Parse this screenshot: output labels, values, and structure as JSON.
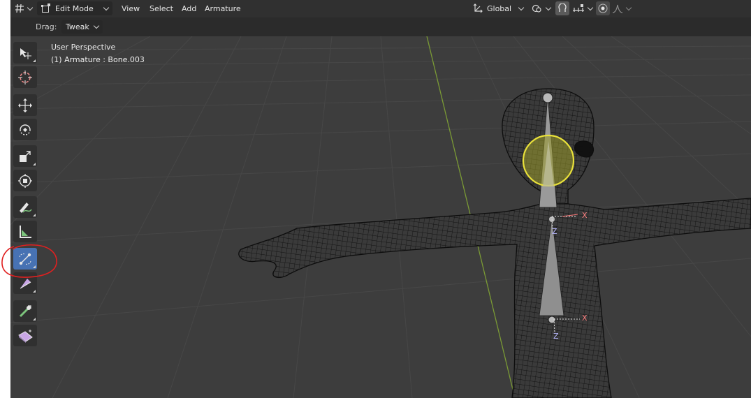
{
  "header": {
    "editor_type_icon": "grid-icon",
    "mode": "Edit Mode",
    "menus": [
      "View",
      "Select",
      "Add",
      "Armature"
    ],
    "orientation": "Global",
    "pivot_icon": "pivot-icon",
    "snap_icon": "snap-magnet-icon",
    "snap_target_icon": "snap-increment-icon",
    "proportional_icon": "proportional-edit-icon",
    "falloff_icon": "falloff-curve-icon"
  },
  "tool_settings": {
    "drag_label": "Drag:",
    "drag_value": "Tweak"
  },
  "viewport": {
    "view_name": "User Perspective",
    "object_info": "(1) Armature : Bone.003",
    "axis_labels": {
      "x1": "X",
      "z1": "Z",
      "x2": "X",
      "z2": "Z"
    }
  },
  "toolbar": {
    "tools": [
      {
        "name": "select-box-tool",
        "icon": "select-box-icon",
        "active": false
      },
      {
        "name": "cursor-tool",
        "icon": "cursor-icon",
        "active": false
      },
      {
        "name": "move-tool",
        "icon": "move-icon",
        "active": false
      },
      {
        "name": "rotate-tool",
        "icon": "rotate-icon",
        "active": false
      },
      {
        "name": "scale-tool",
        "icon": "scale-icon",
        "active": false
      },
      {
        "name": "transform-tool",
        "icon": "transform-icon",
        "active": false
      },
      {
        "name": "annotate-tool",
        "icon": "annotate-icon",
        "active": false
      },
      {
        "name": "measure-tool",
        "icon": "measure-icon",
        "active": false
      },
      {
        "name": "roll-tool",
        "icon": "bone-roll-icon",
        "active": true
      },
      {
        "name": "bone-size-tool",
        "icon": "bone-size-icon",
        "active": false
      },
      {
        "name": "extrude-tool",
        "icon": "extrude-icon",
        "active": false
      },
      {
        "name": "bone-envelope-tool",
        "icon": "bone-envelope-icon",
        "active": false
      }
    ]
  },
  "colors": {
    "header_bg": "#303030",
    "viewport_bg": "#3d3d3d",
    "active_tool": "#4772b3",
    "grid_y_axis": "#7a9a35",
    "selection_circle": "#e8e03a",
    "annotation": "#e02020"
  }
}
